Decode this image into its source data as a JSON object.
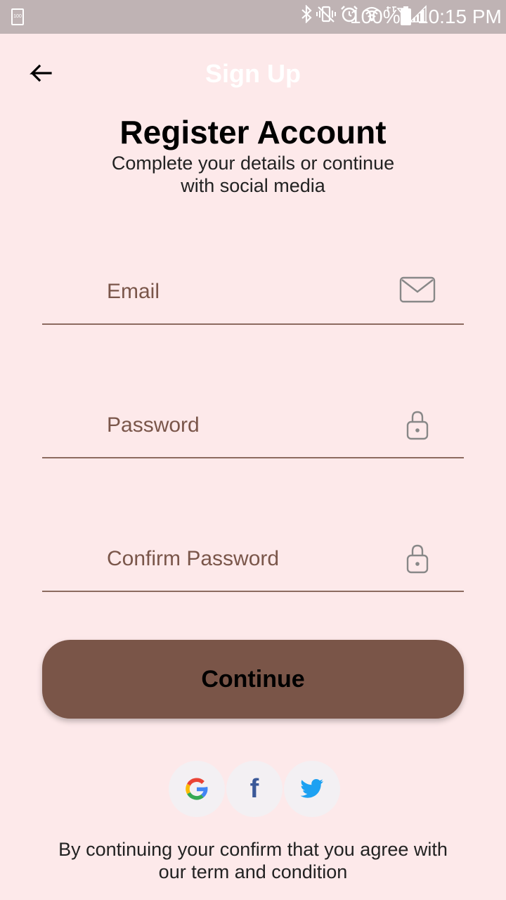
{
  "status_bar": {
    "battery_small_label": "100",
    "battery_percent": "100%",
    "time": "10:15 PM",
    "icons": [
      "bluetooth-icon",
      "vibrate-icon",
      "alarm-icon",
      "wifi-icon",
      "signal-icon",
      "battery-icon"
    ]
  },
  "app_bar": {
    "title": "Sign Up",
    "back_icon": "arrow-left-icon"
  },
  "header": {
    "title": "Register Account",
    "subtitle": "Complete your details or continue with social media"
  },
  "form": {
    "email": {
      "placeholder": "Email",
      "value": "",
      "icon": "mail-icon"
    },
    "password": {
      "placeholder": "Password",
      "value": "",
      "icon": "lock-icon"
    },
    "confirm_password": {
      "placeholder": "Confirm Password",
      "value": "",
      "icon": "lock-icon"
    },
    "continue_label": "Continue"
  },
  "social": {
    "google": {
      "label": "G",
      "icon": "google-icon"
    },
    "facebook": {
      "label": "f",
      "icon": "facebook-icon"
    },
    "twitter": {
      "icon": "twitter-icon"
    }
  },
  "footer": {
    "terms": "By continuing your confirm that you agree with our term and condition"
  },
  "colors": {
    "background": "#fde9ea",
    "primary": "#7a5548",
    "field_text": "#7a564a"
  }
}
